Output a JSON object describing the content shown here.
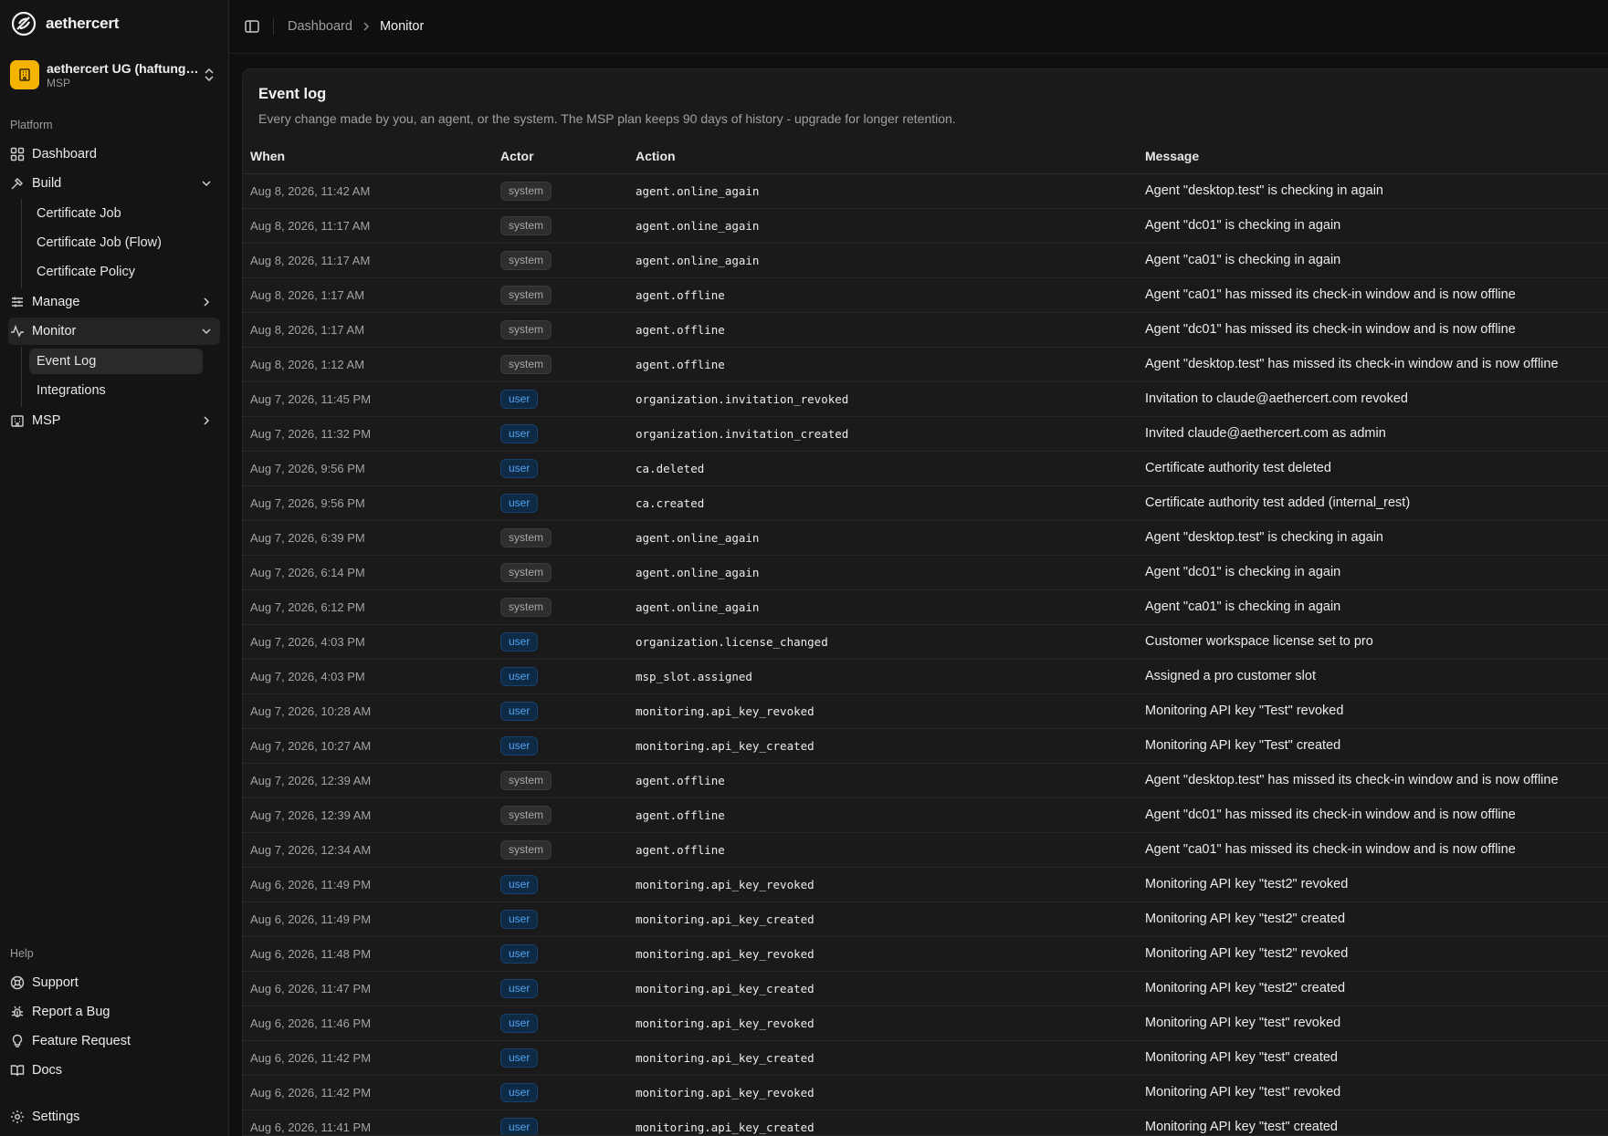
{
  "brand": {
    "name": "aethercert"
  },
  "org": {
    "name": "aethercert UG (haftungsbeschränkt)",
    "plan": "MSP"
  },
  "sidebar": {
    "platform_label": "Platform",
    "dashboard": "Dashboard",
    "build": "Build",
    "build_items": [
      "Certificate Job",
      "Certificate Job (Flow)",
      "Certificate Policy"
    ],
    "manage": "Manage",
    "monitor": "Monitor",
    "monitor_items": [
      "Event Log",
      "Integrations"
    ],
    "msp": "MSP",
    "help_label": "Help",
    "support": "Support",
    "report_bug": "Report a Bug",
    "feature_request": "Feature Request",
    "docs": "Docs",
    "settings": "Settings"
  },
  "breadcrumb": {
    "root": "Dashboard",
    "current": "Monitor"
  },
  "panel": {
    "title": "Event log",
    "description": "Every change made by you, an agent, or the system. The MSP plan keeps 90 days of history - upgrade for longer retention."
  },
  "table": {
    "headers": {
      "when": "When",
      "actor": "Actor",
      "action": "Action",
      "message": "Message"
    },
    "rows": [
      {
        "when": "Aug 8, 2026, 11:42 AM",
        "actor": "system",
        "action": "agent.online_again",
        "message": "Agent \"desktop.test\" is checking in again"
      },
      {
        "when": "Aug 8, 2026, 11:17 AM",
        "actor": "system",
        "action": "agent.online_again",
        "message": "Agent \"dc01\" is checking in again"
      },
      {
        "when": "Aug 8, 2026, 11:17 AM",
        "actor": "system",
        "action": "agent.online_again",
        "message": "Agent \"ca01\" is checking in again"
      },
      {
        "when": "Aug 8, 2026, 1:17 AM",
        "actor": "system",
        "action": "agent.offline",
        "message": "Agent \"ca01\" has missed its check-in window and is now offline"
      },
      {
        "when": "Aug 8, 2026, 1:17 AM",
        "actor": "system",
        "action": "agent.offline",
        "message": "Agent \"dc01\" has missed its check-in window and is now offline"
      },
      {
        "when": "Aug 8, 2026, 1:12 AM",
        "actor": "system",
        "action": "agent.offline",
        "message": "Agent \"desktop.test\" has missed its check-in window and is now offline"
      },
      {
        "when": "Aug 7, 2026, 11:45 PM",
        "actor": "user",
        "action": "organization.invitation_revoked",
        "message": "Invitation to claude@aethercert.com revoked"
      },
      {
        "when": "Aug 7, 2026, 11:32 PM",
        "actor": "user",
        "action": "organization.invitation_created",
        "message": "Invited claude@aethercert.com as admin"
      },
      {
        "when": "Aug 7, 2026, 9:56 PM",
        "actor": "user",
        "action": "ca.deleted",
        "message": "Certificate authority test deleted"
      },
      {
        "when": "Aug 7, 2026, 9:56 PM",
        "actor": "user",
        "action": "ca.created",
        "message": "Certificate authority test added (internal_rest)"
      },
      {
        "when": "Aug 7, 2026, 6:39 PM",
        "actor": "system",
        "action": "agent.online_again",
        "message": "Agent \"desktop.test\" is checking in again"
      },
      {
        "when": "Aug 7, 2026, 6:14 PM",
        "actor": "system",
        "action": "agent.online_again",
        "message": "Agent \"dc01\" is checking in again"
      },
      {
        "when": "Aug 7, 2026, 6:12 PM",
        "actor": "system",
        "action": "agent.online_again",
        "message": "Agent \"ca01\" is checking in again"
      },
      {
        "when": "Aug 7, 2026, 4:03 PM",
        "actor": "user",
        "action": "organization.license_changed",
        "message": "Customer workspace license set to pro"
      },
      {
        "when": "Aug 7, 2026, 4:03 PM",
        "actor": "user",
        "action": "msp_slot.assigned",
        "message": "Assigned a pro customer slot"
      },
      {
        "when": "Aug 7, 2026, 10:28 AM",
        "actor": "user",
        "action": "monitoring.api_key_revoked",
        "message": "Monitoring API key \"Test\" revoked"
      },
      {
        "when": "Aug 7, 2026, 10:27 AM",
        "actor": "user",
        "action": "monitoring.api_key_created",
        "message": "Monitoring API key \"Test\" created"
      },
      {
        "when": "Aug 7, 2026, 12:39 AM",
        "actor": "system",
        "action": "agent.offline",
        "message": "Agent \"desktop.test\" has missed its check-in window and is now offline"
      },
      {
        "when": "Aug 7, 2026, 12:39 AM",
        "actor": "system",
        "action": "agent.offline",
        "message": "Agent \"dc01\" has missed its check-in window and is now offline"
      },
      {
        "when": "Aug 7, 2026, 12:34 AM",
        "actor": "system",
        "action": "agent.offline",
        "message": "Agent \"ca01\" has missed its check-in window and is now offline"
      },
      {
        "when": "Aug 6, 2026, 11:49 PM",
        "actor": "user",
        "action": "monitoring.api_key_revoked",
        "message": "Monitoring API key \"test2\" revoked"
      },
      {
        "when": "Aug 6, 2026, 11:49 PM",
        "actor": "user",
        "action": "monitoring.api_key_created",
        "message": "Monitoring API key \"test2\" created"
      },
      {
        "when": "Aug 6, 2026, 11:48 PM",
        "actor": "user",
        "action": "monitoring.api_key_revoked",
        "message": "Monitoring API key \"test2\" revoked"
      },
      {
        "when": "Aug 6, 2026, 11:47 PM",
        "actor": "user",
        "action": "monitoring.api_key_created",
        "message": "Monitoring API key \"test2\" created"
      },
      {
        "when": "Aug 6, 2026, 11:46 PM",
        "actor": "user",
        "action": "monitoring.api_key_revoked",
        "message": "Monitoring API key \"test\" revoked"
      },
      {
        "when": "Aug 6, 2026, 11:42 PM",
        "actor": "user",
        "action": "monitoring.api_key_created",
        "message": "Monitoring API key \"test\" created"
      },
      {
        "when": "Aug 6, 2026, 11:42 PM",
        "actor": "user",
        "action": "monitoring.api_key_revoked",
        "message": "Monitoring API key \"test\" revoked"
      },
      {
        "when": "Aug 6, 2026, 11:41 PM",
        "actor": "user",
        "action": "monitoring.api_key_created",
        "message": "Monitoring API key \"test\" created"
      }
    ]
  },
  "colors": {
    "org_avatar": "#f5b301",
    "user_badge": "#4ea3f5",
    "background": "#0f0f0f"
  }
}
